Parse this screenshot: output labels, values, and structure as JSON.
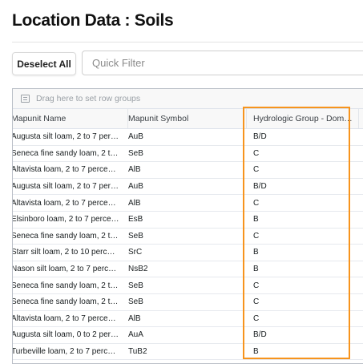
{
  "page": {
    "title": "Location Data : Soils"
  },
  "toolbar": {
    "deselect_label": "Deselect All",
    "quick_filter_placeholder": "Quick Filter"
  },
  "grid": {
    "group_panel_text": "Drag here to set row groups",
    "columns": [
      "Mapunit Name",
      "Mapunit Symbol",
      "Hydrologic Group - Dom…"
    ],
    "rows": [
      {
        "name": "Augusta silt loam, 2 to 7 per…",
        "symbol": "AuB",
        "hydro": "B/D"
      },
      {
        "name": "Seneca fine sandy loam, 2 t…",
        "symbol": "SeB",
        "hydro": "C"
      },
      {
        "name": "Altavista loam, 2 to 7 perce…",
        "symbol": "AlB",
        "hydro": "C"
      },
      {
        "name": "Augusta silt loam, 2 to 7 per…",
        "symbol": "AuB",
        "hydro": "B/D"
      },
      {
        "name": "Altavista loam, 2 to 7 perce…",
        "symbol": "AlB",
        "hydro": "C"
      },
      {
        "name": "Elsinboro loam, 2 to 7 perce…",
        "symbol": "EsB",
        "hydro": "B"
      },
      {
        "name": "Seneca fine sandy loam, 2 t…",
        "symbol": "SeB",
        "hydro": "C"
      },
      {
        "name": "Starr silt loam, 2 to 10 perc…",
        "symbol": "SrC",
        "hydro": "B"
      },
      {
        "name": "Nason silt loam, 2 to 7 perc…",
        "symbol": "NsB2",
        "hydro": "B"
      },
      {
        "name": "Seneca fine sandy loam, 2 t…",
        "symbol": "SeB",
        "hydro": "C"
      },
      {
        "name": "Seneca fine sandy loam, 2 t…",
        "symbol": "SeB",
        "hydro": "C"
      },
      {
        "name": "Altavista loam, 2 to 7 perce…",
        "symbol": "AlB",
        "hydro": "C"
      },
      {
        "name": "Augusta silt loam, 0 to 2 per…",
        "symbol": "AuA",
        "hydro": "B/D"
      },
      {
        "name": "Turbeville loam, 2 to 7 perc…",
        "symbol": "TuB2",
        "hydro": "B"
      }
    ]
  },
  "colors": {
    "highlight": "#f7941d"
  }
}
